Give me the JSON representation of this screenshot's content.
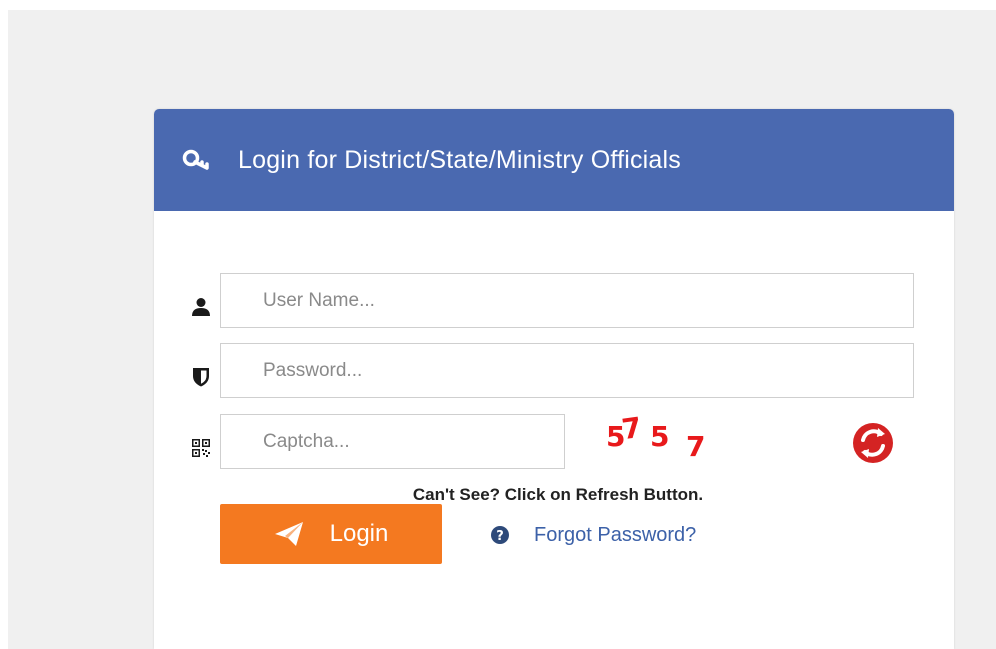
{
  "panel": {
    "title": "Login for District/State/Ministry Officials",
    "header_color": "#4a69b0"
  },
  "form": {
    "username": {
      "placeholder": "User Name...",
      "value": ""
    },
    "password": {
      "placeholder": "Password...",
      "value": ""
    },
    "captcha": {
      "placeholder": "Captcha...",
      "value": ""
    }
  },
  "captcha_image": {
    "characters": [
      "5",
      "7",
      "5",
      "7"
    ],
    "color": "#e8191b"
  },
  "hint": "Can't See? Click on Refresh Button.",
  "actions": {
    "login_label": "Login",
    "login_color": "#f47920",
    "forgot_label": "Forgot Password?"
  },
  "icons": {
    "header": "key-icon",
    "username": "user-icon",
    "password": "shield-icon",
    "captcha": "qrcode-icon",
    "refresh": "refresh-icon",
    "login": "paper-plane-icon",
    "forgot": "question-circle-icon"
  }
}
